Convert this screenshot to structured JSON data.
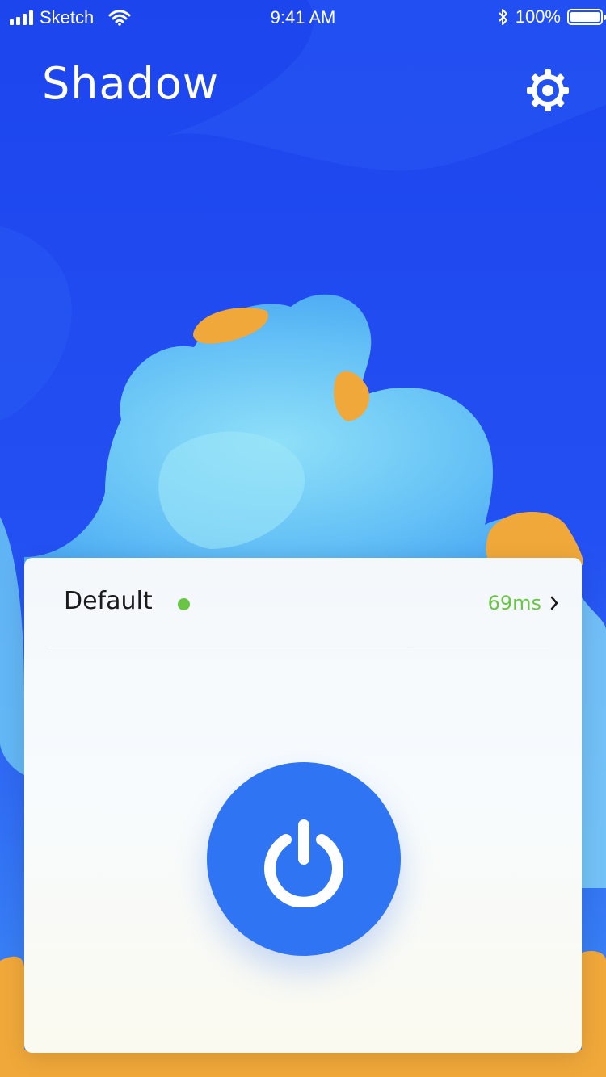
{
  "status_bar": {
    "carrier": "Sketch",
    "time": "9:41 AM",
    "battery": "100%"
  },
  "header": {
    "title": "Shadow",
    "settings_icon": "gear-icon"
  },
  "server": {
    "name": "Default",
    "latency": "69ms",
    "status_color": "#6bc545"
  },
  "power_button": {
    "icon": "power-icon",
    "color": "#2f74f3"
  },
  "colors": {
    "background_blue": "#1f4bf0",
    "blob_light_blue": "#6cc6f5",
    "blob_orange": "#f0a83a",
    "latency_green": "#6bc545"
  }
}
